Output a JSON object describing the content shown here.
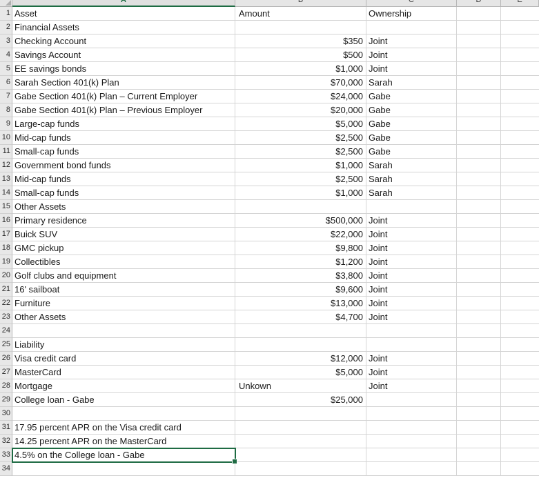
{
  "application": "spreadsheet",
  "colors": {
    "accent": "#1e6b43",
    "gridline": "#d4d4d4",
    "header_fill": "#e6e6e6",
    "row_header_fill": "#e8e8e8"
  },
  "columns": [
    {
      "letter": "A",
      "active": true
    },
    {
      "letter": "B",
      "active": false
    },
    {
      "letter": "C",
      "active": false
    },
    {
      "letter": "D",
      "active": false
    },
    {
      "letter": "E",
      "active": false
    }
  ],
  "selection": {
    "cell": "A33",
    "row_index": 33,
    "column": "A"
  },
  "sheet": {
    "headers": {
      "a": "Asset",
      "b": "Amount",
      "c": "Ownership"
    },
    "rows": [
      {
        "n": 1,
        "a": "Asset",
        "b": "Amount",
        "c": "Ownership",
        "b_align": "left"
      },
      {
        "n": 2,
        "a": "Financial Assets",
        "b": "",
        "c": ""
      },
      {
        "n": 3,
        "a": "Checking Account",
        "b": "$350",
        "c": "Joint"
      },
      {
        "n": 4,
        "a": "Savings Account",
        "b": "$500",
        "c": "Joint"
      },
      {
        "n": 5,
        "a": "EE savings bonds",
        "b": "$1,000",
        "c": "Joint"
      },
      {
        "n": 6,
        "a": "Sarah Section 401(k) Plan",
        "b": "$70,000",
        "c": "Sarah"
      },
      {
        "n": 7,
        "a": "Gabe Section 401(k) Plan – Current Employer",
        "b": "$24,000",
        "c": "Gabe"
      },
      {
        "n": 8,
        "a": "Gabe Section 401(k) Plan – Previous Employer",
        "b": "$20,000",
        "c": " Gabe"
      },
      {
        "n": 9,
        "a": "Large-cap funds",
        "b": "$5,000",
        "c": "Gabe"
      },
      {
        "n": 10,
        "a": "Mid-cap funds",
        "b": "$2,500",
        "c": "Gabe"
      },
      {
        "n": 11,
        "a": "Small-cap funds",
        "b": "$2,500",
        "c": "Gabe"
      },
      {
        "n": 12,
        "a": "Government bond funds",
        "b": "$1,000",
        "c": "Sarah"
      },
      {
        "n": 13,
        "a": "Mid-cap funds",
        "b": "$2,500",
        "c": "Sarah"
      },
      {
        "n": 14,
        "a": "Small-cap funds",
        "b": "$1,000",
        "c": "Sarah"
      },
      {
        "n": 15,
        "a": "Other Assets",
        "b": "",
        "c": ""
      },
      {
        "n": 16,
        "a": "Primary residence",
        "b": "$500,000",
        "c": "Joint"
      },
      {
        "n": 17,
        "a": "Buick SUV",
        "b": "$22,000",
        "c": "Joint"
      },
      {
        "n": 18,
        "a": "GMC pickup",
        "b": "$9,800",
        "c": "Joint"
      },
      {
        "n": 19,
        "a": "Collectibles",
        "b": "$1,200",
        "c": "Joint"
      },
      {
        "n": 20,
        "a": "Golf clubs and equipment",
        "b": "$3,800",
        "c": "Joint"
      },
      {
        "n": 21,
        "a": "16' sailboat",
        "b": "$9,600",
        "c": "Joint"
      },
      {
        "n": 22,
        "a": "Furniture",
        "b": "$13,000",
        "c": "Joint"
      },
      {
        "n": 23,
        "a": "Other Assets",
        "b": "$4,700",
        "c": "Joint"
      },
      {
        "n": 24,
        "a": "",
        "b": "",
        "c": ""
      },
      {
        "n": 25,
        "a": "Liability",
        "b": "",
        "c": ""
      },
      {
        "n": 26,
        "a": "Visa credit card",
        "b": "$12,000",
        "c": "Joint"
      },
      {
        "n": 27,
        "a": "MasterCard",
        "b": "$5,000",
        "c": "Joint"
      },
      {
        "n": 28,
        "a": "Mortgage",
        "b": "Unkown",
        "c": "Joint",
        "b_align": "left"
      },
      {
        "n": 29,
        "a": "College loan - Gabe",
        "b": "$25,000",
        "c": ""
      },
      {
        "n": 30,
        "a": "",
        "b": "",
        "c": ""
      },
      {
        "n": 31,
        "a": "17.95 percent APR on the Visa credit card",
        "b": "",
        "c": ""
      },
      {
        "n": 32,
        "a": "14.25 percent APR on the MasterCard",
        "b": "",
        "c": ""
      },
      {
        "n": 33,
        "a": "4.5% on the College loan - Gabe",
        "b": "",
        "c": ""
      },
      {
        "n": 34,
        "a": "",
        "b": "",
        "c": ""
      }
    ]
  }
}
